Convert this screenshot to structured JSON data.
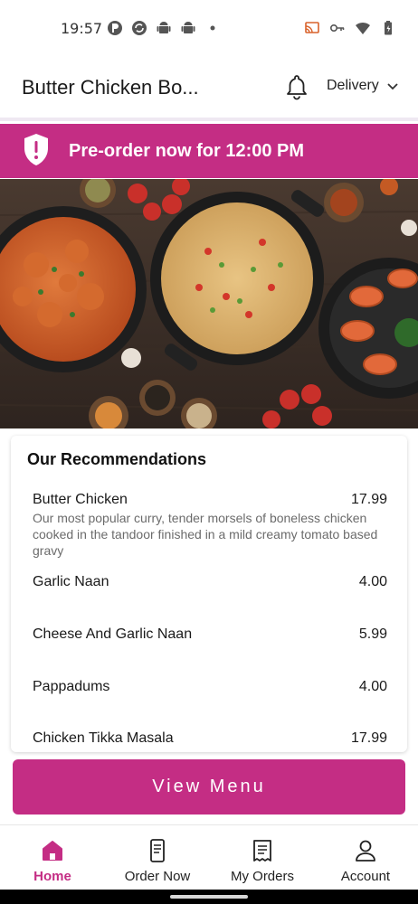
{
  "status_bar": {
    "time": "19:57",
    "left_icons": [
      "app-notification-icon",
      "sync-icon",
      "android-icon",
      "android-icon",
      "dot-icon"
    ],
    "right_icons": [
      "cast-icon",
      "key-icon",
      "wifi-icon",
      "battery-icon"
    ]
  },
  "header": {
    "restaurant_name": "Butter Chicken Bo...",
    "order_type": "Delivery"
  },
  "banner": {
    "text": "Pre-order now for 12:00 PM"
  },
  "recommendations": {
    "title": "Our Recommendations",
    "items": [
      {
        "name": "Butter Chicken",
        "price": "17.99",
        "description": "Our most popular curry, tender morsels of boneless chicken cooked in the tandoor finished in a mild creamy tomato based gravy"
      },
      {
        "name": "Garlic Naan",
        "price": "4.00"
      },
      {
        "name": "Cheese And Garlic Naan",
        "price": "5.99"
      },
      {
        "name": "Pappadums",
        "price": "4.00"
      },
      {
        "name": "Chicken Tikka Masala",
        "price": "17.99"
      }
    ]
  },
  "view_menu_label": "View Menu",
  "nav": {
    "items": [
      {
        "label": "Home",
        "icon": "home-icon",
        "active": true
      },
      {
        "label": "Order Now",
        "icon": "order-phone-icon",
        "active": false
      },
      {
        "label": "My Orders",
        "icon": "receipt-icon",
        "active": false
      },
      {
        "label": "Account",
        "icon": "user-icon",
        "active": false
      }
    ]
  },
  "colors": {
    "brand": "#c42d84",
    "header_divider": "#efe8f2",
    "text": "#1a1a1a",
    "muted": "#6b6b6b"
  }
}
